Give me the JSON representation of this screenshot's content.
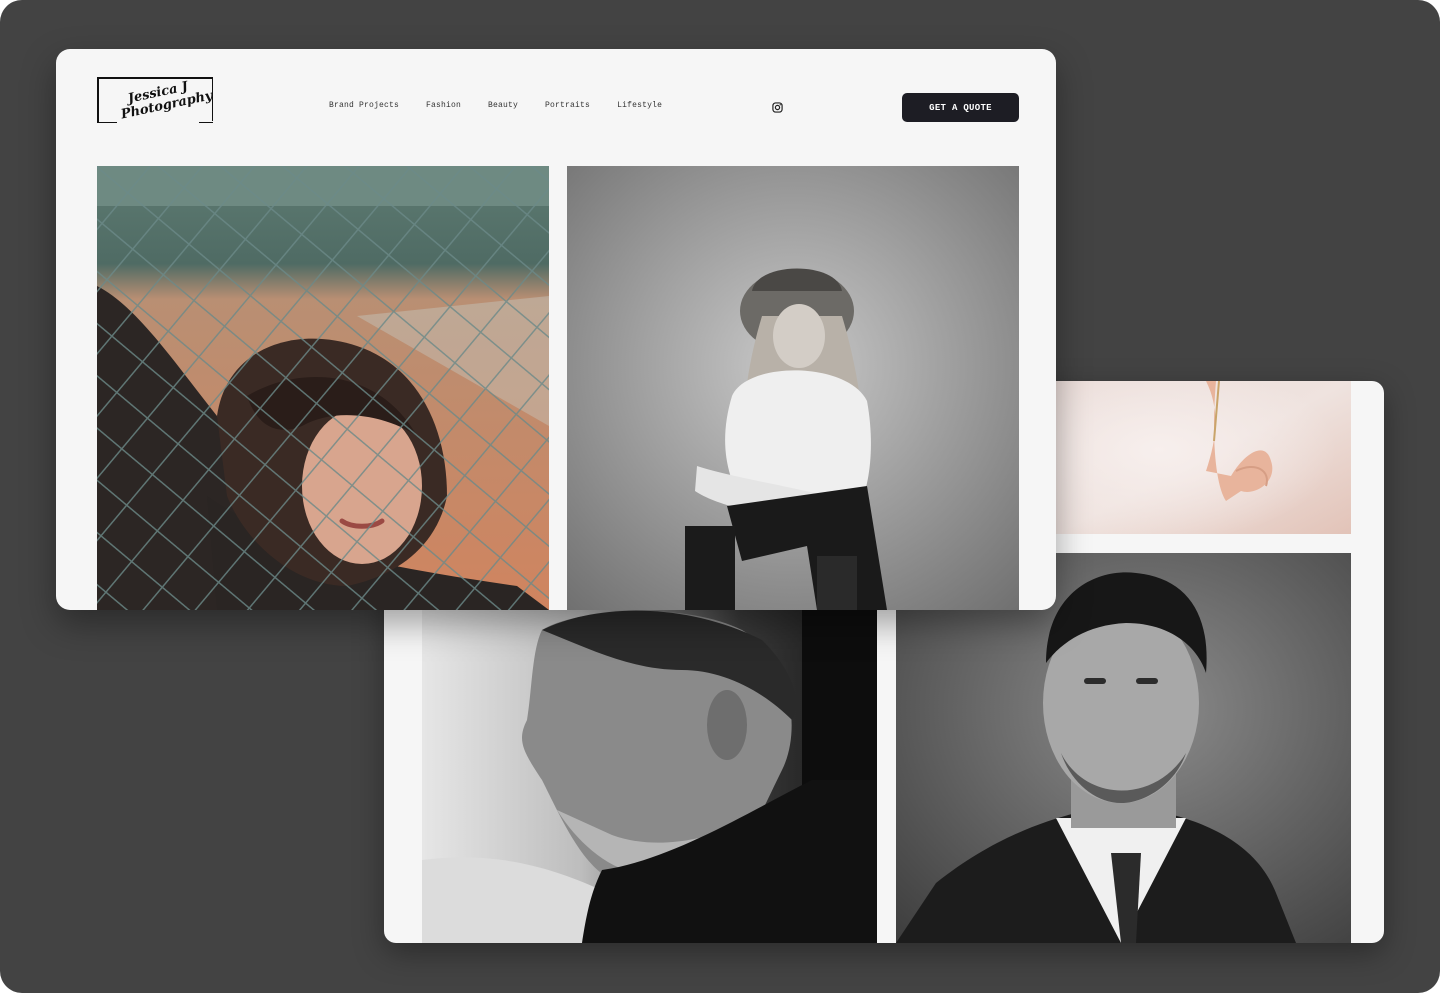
{
  "site": {
    "logo": {
      "line1": "Jessica J",
      "line2": "Photography"
    },
    "nav": [
      {
        "label": "Brand Projects"
      },
      {
        "label": "Fashion"
      },
      {
        "label": "Beauty"
      },
      {
        "label": "Portraits"
      },
      {
        "label": "Lifestyle"
      }
    ],
    "social_icon": "instagram-icon",
    "cta_label": "GET A QUOTE"
  },
  "colors": {
    "stage_background": "#434343",
    "card_background": "#f6f6f6",
    "cta_background": "#1d1d24",
    "cta_text": "#ffffff"
  },
  "gallery": {
    "front_photos": [
      "woman-behind-chain-fence-photo",
      "woman-in-hat-sitting-photo"
    ],
    "back_photos": [
      "hand-with-flower-photo",
      "man-profile-turtleneck-photo",
      "man-in-suit-portrait-photo"
    ]
  }
}
